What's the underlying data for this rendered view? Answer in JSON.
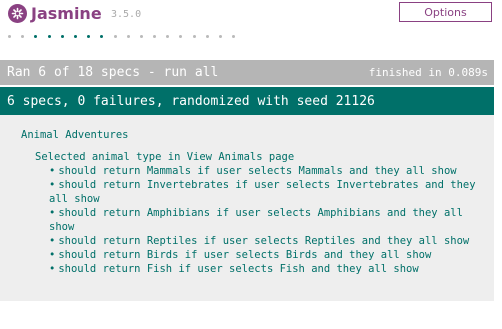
{
  "header": {
    "logo_text": "Jasmine",
    "version": "3.5.0",
    "options_label": "Options"
  },
  "spec_dots": {
    "total": 18,
    "ran": [
      false,
      false,
      true,
      true,
      true,
      true,
      true,
      true,
      false,
      false,
      false,
      false,
      false,
      false,
      false,
      false,
      false,
      false
    ],
    "colors": {
      "passed": "#007069",
      "skipped": "#bababa"
    }
  },
  "summary": {
    "text": "Ran 6 of 18 specs - run all",
    "finished": "finished in 0.089s"
  },
  "result": {
    "text": "6 specs, 0 failures, randomized with seed 21126"
  },
  "suite": {
    "title": "Animal Adventures",
    "group": "Selected animal type in View Animals page",
    "specs": [
      "should return Mammals if user selects Mammals and they all show",
      "should return Invertebrates if user selects Invertebrates and they all show",
      "should return Amphibians if user selects Amphibians and they all show",
      "should return Reptiles if user selects Reptiles and they all show",
      "should return Birds if user selects Birds and they all show",
      "should return Fish if user selects Fish and they all show"
    ],
    "bullet": "•"
  },
  "colors": {
    "brand": "#8a4182",
    "passed": "#007069",
    "summary_bar": "#b5b5b5",
    "results_bg": "#eeeeee"
  }
}
